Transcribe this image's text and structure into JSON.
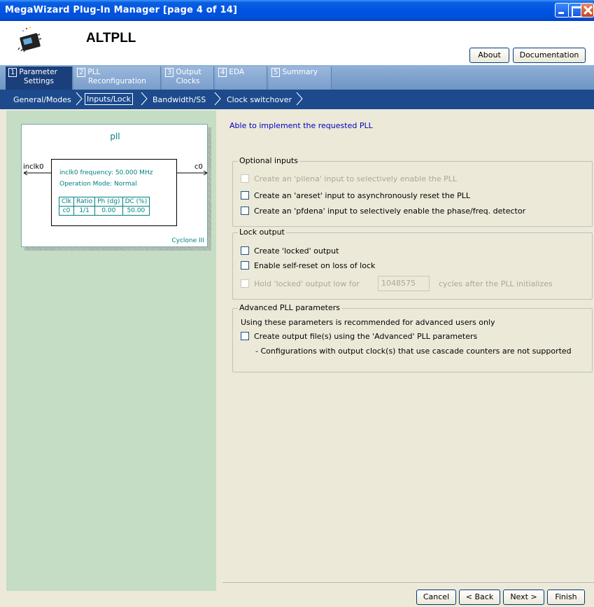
{
  "window": {
    "title": "MegaWizard Plug-In Manager [page 4 of 14]"
  },
  "header": {
    "plugin_name": "ALTPLL",
    "about_label": "About",
    "documentation_label": "Documentation"
  },
  "tabs": [
    {
      "num": "1",
      "line1": "Parameter",
      "line2": "Settings"
    },
    {
      "num": "2",
      "line1": "PLL",
      "line2": "Reconfiguration"
    },
    {
      "num": "3",
      "line1": "Output",
      "line2": "Clocks"
    },
    {
      "num": "4",
      "line1": "EDA",
      "line2": ""
    },
    {
      "num": "5",
      "line1": "Summary",
      "line2": ""
    }
  ],
  "subnav": [
    "General/Modes",
    "Inputs/Lock",
    "Bandwidth/SS",
    "Clock switchover"
  ],
  "diagram": {
    "title": "pll",
    "input_label": "inclk0",
    "output_label": "c0",
    "freq_text": "inclk0 frequency: 50.000 MHz",
    "mode_text": "Operation Mode: Normal",
    "table_headers": [
      "Clk",
      "Ratio",
      "Ph (dg)",
      "DC (%)"
    ],
    "table_row": [
      "c0",
      "1/1",
      "0.00",
      "50.00"
    ],
    "device": "Cyclone III"
  },
  "status_text": "Able to implement the requested PLL",
  "optional_inputs": {
    "legend": "Optional inputs",
    "pllena": "Create an 'pllena' input to selectively enable the PLL",
    "areset": "Create an 'areset' input to asynchronously reset the PLL",
    "pfdena": "Create an 'pfdena' input to selectively enable the phase/freq. detector"
  },
  "lock_output": {
    "legend": "Lock output",
    "locked": "Create 'locked' output",
    "self_reset": "Enable self-reset on loss of lock",
    "hold_prefix": "Hold 'locked' output low for",
    "hold_value": "1048575",
    "hold_suffix": "cycles after the PLL initializes"
  },
  "advanced": {
    "legend": "Advanced PLL parameters",
    "note": "Using these parameters is recommended for advanced users only",
    "create_files": "Create output file(s) using the 'Advanced' PLL parameters",
    "config_note": "- Configurations with output clock(s) that use cascade counters are not supported"
  },
  "footer": {
    "cancel": "Cancel",
    "back": "< Back",
    "next": "Next >",
    "finish": "Finish"
  }
}
